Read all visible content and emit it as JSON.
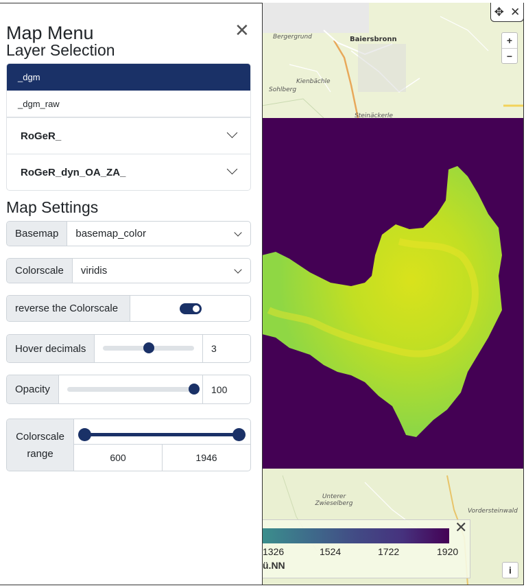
{
  "panel": {
    "title": "Map Menu",
    "close_icon": "close-icon"
  },
  "layer_selection": {
    "title": "Layer Selection",
    "items": [
      {
        "label": "_dgm",
        "active": true
      },
      {
        "label": "_dgm_raw",
        "active": false
      }
    ],
    "groups": [
      {
        "label": "RoGeR_"
      },
      {
        "label": "RoGeR_dyn_OA_ZA_"
      }
    ]
  },
  "map_settings": {
    "title": "Map Settings",
    "basemap": {
      "label": "Basemap",
      "value": "basemap_color"
    },
    "colorscale": {
      "label": "Colorscale",
      "value": "viridis"
    },
    "reverse": {
      "label": "reverse the Colorscale",
      "enabled": true
    },
    "hover_decimals": {
      "label": "Hover decimals",
      "value": "3",
      "fraction": 0.5
    },
    "opacity": {
      "label": "Opacity",
      "value": "100",
      "fraction": 1.0
    },
    "colorscale_range": {
      "label_line1": "Colorscale",
      "label_line2": "range",
      "min": "600",
      "max": "1946"
    }
  },
  "map": {
    "places": [
      "Bergergrund",
      "Baiersbronn",
      "Kienbächle",
      "Sohlberg",
      "Steinäckerle",
      "Unterer Zwieselberg",
      "Vordersteinwald"
    ],
    "zoom_in": "+",
    "zoom_out": "−",
    "move_icon": "move-icon",
    "close_icon": "close-icon",
    "info_label": "i",
    "colors": {
      "low": "#440154",
      "mid": "#8fd744",
      "high": "#fde725",
      "panel_accent": "#1a3167"
    }
  },
  "legend": {
    "ticks": [
      "1326",
      "1524",
      "1722",
      "1920"
    ],
    "unit": "ü.NN"
  }
}
